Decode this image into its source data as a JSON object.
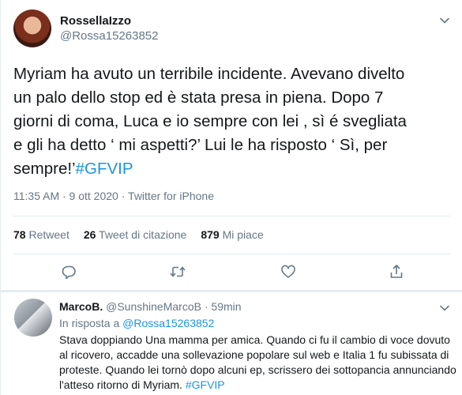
{
  "tweet": {
    "author_name": "RossellaIzzo",
    "author_handle": "@Rossa15263852",
    "text": "Myriam ha avuto un terribile incidente. Avevano divelto\nun palo dello stop ed è stata presa in piena. Dopo 7\ngiorni di coma, Luca e io sempre con lei , sì é  svegliata\ne gli ha detto ‘ mi aspetti?’ Lui le ha risposto ‘ Sì, per\nsempre!’",
    "hashtag": "#GFVIP",
    "time": "11:35 AM · 9 ott 2020",
    "separator": " · ",
    "source": "Twitter for iPhone"
  },
  "stats": {
    "retweets_count": "78",
    "retweets_label": "Retweet",
    "quotes_count": "26",
    "quotes_label": "Tweet di citazione",
    "likes_count": "879",
    "likes_label": "Mi piace"
  },
  "icons": {
    "caret": "chevron-down-icon",
    "reply": "reply-icon",
    "retweet": "retweet-icon",
    "like": "heart-icon",
    "share": "share-icon"
  },
  "colors": {
    "accent": "#1b95e0",
    "secondary_text": "#657786",
    "divider": "#e6ecf0"
  },
  "reply": {
    "author_name": "MarcoB.",
    "author_handle": "@SunshineMarcoB",
    "separator": " · ",
    "time": "59min",
    "in_reply_prefix": "In risposta a ",
    "in_reply_handle": "@Rossa15263852",
    "text": "Stava doppiando Una mamma per amica. Quando ci fu il cambio di voce dovuto al ricovero, accadde una sollevazione popolare sul web e Italia 1 fu subissata di proteste. Quando lei tornò dopo alcuni ep, scrissero dei sottopancia annunciando l'atteso ritorno di Myriam. ",
    "hashtag": "#GFVIP"
  }
}
